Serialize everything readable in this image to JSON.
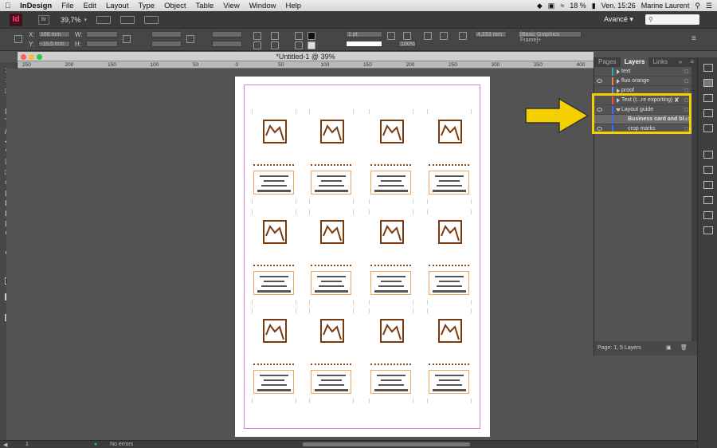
{
  "menubar": {
    "app_name": "InDesign",
    "items": [
      "File",
      "Edit",
      "Layout",
      "Type",
      "Object",
      "Table",
      "View",
      "Window",
      "Help"
    ],
    "battery": "18 %",
    "clock": "Ven. 15:26",
    "user": "Marine Laurent"
  },
  "appbar": {
    "logo": "Id",
    "bridge": "Br",
    "zoom": "39,7%",
    "workspace": "Avancé",
    "search_placeholder": ""
  },
  "controlbar": {
    "x_label": "X:",
    "y_label": "Y:",
    "w_label": "W:",
    "h_label": "H:",
    "x_value": "166 mm",
    "y_value": "-16,5 mm",
    "stroke_weight": "1 pt",
    "zoom_pct": "100%",
    "dimension": "4,233 mm",
    "style": "[Basic Graphics Frame]+"
  },
  "document": {
    "title": "*Untitled-1 @ 39%"
  },
  "ruler": {
    "h_ticks": [
      "250",
      "200",
      "150",
      "100",
      "50",
      "0",
      "50",
      "100",
      "150",
      "200",
      "250",
      "300",
      "350",
      "400"
    ],
    "v_ticks": [
      "300",
      "350",
      "400"
    ]
  },
  "layers_panel": {
    "tabs": [
      "Pages",
      "Layers",
      "Links"
    ],
    "active_tab": "Layers",
    "layers": [
      {
        "name": "text",
        "color": "#3aa6a6",
        "visible": false
      },
      {
        "name": "fluo orange",
        "color": "#ff7a3d",
        "visible": true
      },
      {
        "name": "proof",
        "color": "#6c8cff",
        "visible": false
      },
      {
        "name": "Text (t...re exporting)",
        "color": "#ff4b4b",
        "visible": false
      },
      {
        "name": "Layout guide",
        "color": "#3a6cff",
        "visible": true
      },
      {
        "name": "Business card and bleed",
        "color": "#3a6cff",
        "visible": false,
        "selected": true
      },
      {
        "name": "crop marks",
        "color": "#3a6cff",
        "visible": true
      }
    ],
    "footer": "Page: 1, 5 Layers"
  },
  "statusbar": {
    "page": "1",
    "errors": "No errors"
  }
}
